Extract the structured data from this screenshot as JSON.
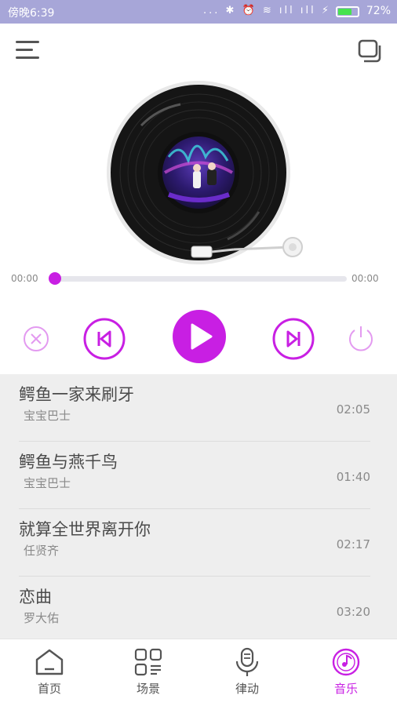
{
  "status_bar": {
    "time": "傍晚6:39",
    "icons_text": "... ✱ ⏰ ≋ ıll ıll ⚡",
    "battery_percent": "72%",
    "battery_level": 0.72,
    "battery_color": "#47e34f"
  },
  "header": {
    "menu_icon": "menu-icon",
    "copy_icon": "copy-icon"
  },
  "player": {
    "current_time": "00:00",
    "total_time": "00:00",
    "progress": 0.0,
    "accent_color": "#c81fe3"
  },
  "controls": {
    "close_icon": "close-circle-icon",
    "prev_icon": "skip-previous-icon",
    "play_icon": "play-icon",
    "next_icon": "skip-next-icon",
    "power_icon": "power-icon"
  },
  "playlist": [
    {
      "title": "鳄鱼一家来刷牙",
      "artist": "宝宝巴士",
      "duration": "02:05"
    },
    {
      "title": "鳄鱼与燕千鸟",
      "artist": "宝宝巴士",
      "duration": "01:40"
    },
    {
      "title": "就算全世界离开你",
      "artist": "任贤齐",
      "duration": "02:17"
    },
    {
      "title": "恋曲",
      "artist": "罗大佑",
      "duration": "03:20"
    }
  ],
  "tabs": [
    {
      "label": "首页",
      "icon": "home-icon",
      "active": false
    },
    {
      "label": "场景",
      "icon": "scene-grid-icon",
      "active": false
    },
    {
      "label": "律动",
      "icon": "microphone-icon",
      "active": false
    },
    {
      "label": "音乐",
      "icon": "music-disc-icon",
      "active": true
    }
  ]
}
